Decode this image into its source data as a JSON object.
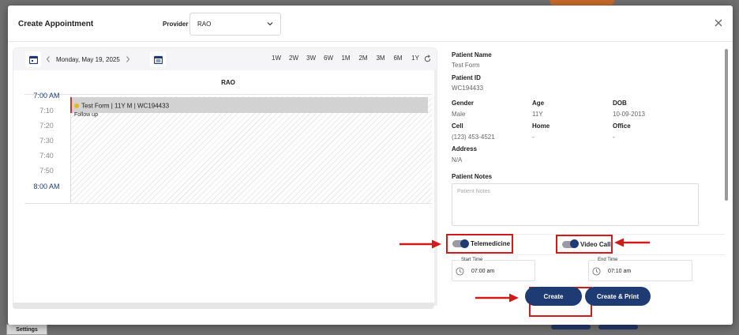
{
  "modal": {
    "title": "Create Appointment",
    "provider_label": "Provider",
    "provider_value": "RAO"
  },
  "calendar": {
    "date": "Monday, May 19, 2025",
    "ranges": [
      "1W",
      "2W",
      "3W",
      "6W",
      "1M",
      "2M",
      "3M",
      "6M",
      "1Y"
    ],
    "column": "RAO",
    "times": [
      {
        "label": "7:00 AM",
        "hour": true
      },
      {
        "label": "7:10",
        "hour": false
      },
      {
        "label": "7:20",
        "hour": false
      },
      {
        "label": "7:30",
        "hour": false
      },
      {
        "label": "7:40",
        "hour": false
      },
      {
        "label": "7:50",
        "hour": false
      },
      {
        "label": "8:00 AM",
        "hour": true
      }
    ],
    "appointment": {
      "title": "Test Form | 11Y M | WC194433",
      "subtitle": "Follow up",
      "dot_color": "#e8b71d"
    }
  },
  "patient": {
    "name_label": "Patient Name",
    "name": "Test Form",
    "id_label": "Patient ID",
    "id": "WC194433",
    "gender_label": "Gender",
    "gender": "Male",
    "age_label": "Age",
    "age": "11Y",
    "dob_label": "DOB",
    "dob": "10-09-2013",
    "cell_label": "Cell",
    "cell": "(123) 453-4521",
    "home_label": "Home",
    "home": "-",
    "office_label": "Office",
    "office": "-",
    "address_label": "Address",
    "address": "N/A",
    "notes_label": "Patient Notes",
    "notes_placeholder": "Patient Notes"
  },
  "toggles": {
    "telemedicine": "Telemedicine",
    "video_call": "Video Call"
  },
  "times": {
    "start_label": "Start Time",
    "start_value": "07:00 am",
    "end_label": "End Time",
    "end_value": "07:10 am"
  },
  "buttons": {
    "create": "Create",
    "create_print": "Create & Print"
  },
  "background": {
    "settings": "Settings"
  },
  "colors": {
    "primary": "#1f3b74",
    "highlight": "#d11a1a"
  }
}
